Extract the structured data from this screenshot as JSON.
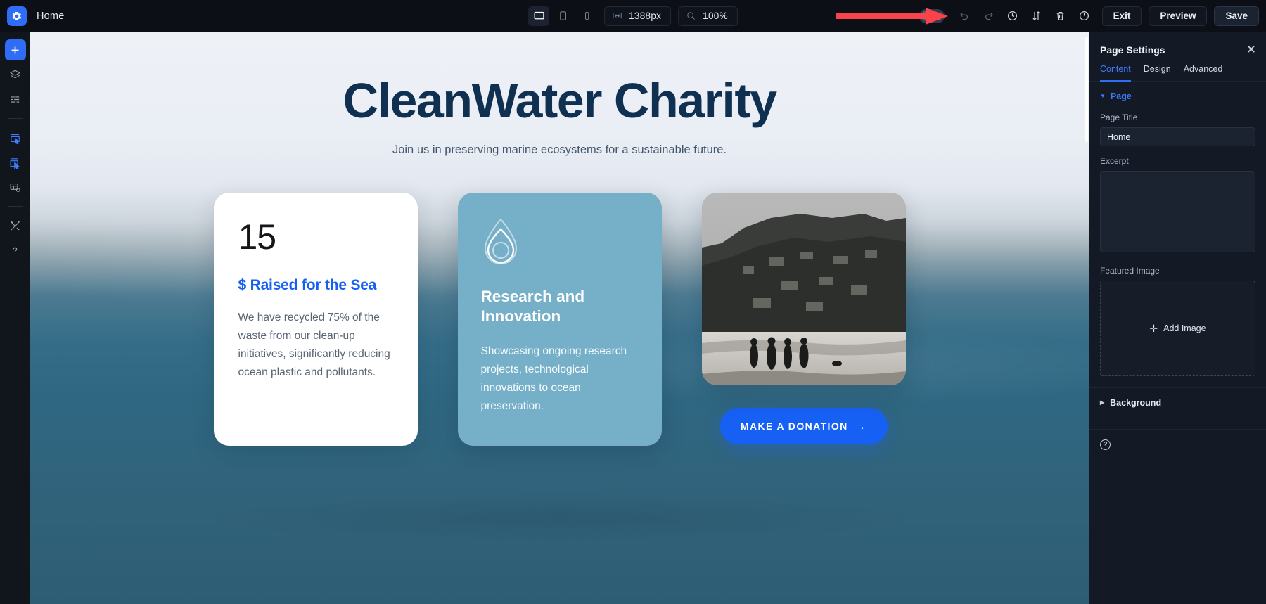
{
  "topbar": {
    "gear_icon": "gear-icon",
    "page_name": "Home",
    "devices": [
      {
        "name": "desktop",
        "icon": "desktop-icon",
        "active": true
      },
      {
        "name": "tablet",
        "icon": "tablet-icon",
        "active": false
      },
      {
        "name": "mobile",
        "icon": "mobile-icon",
        "active": false
      }
    ],
    "width_field": {
      "icon": "width-arrows-icon",
      "value": "1388px"
    },
    "zoom_field": {
      "icon": "magnifier-icon",
      "value": "100%"
    },
    "dark_mode_toggle": {
      "icon": "moon-icon",
      "state": "off"
    },
    "tools": [
      {
        "name": "undo",
        "icon": "undo-icon"
      },
      {
        "name": "redo",
        "icon": "redo-icon"
      },
      {
        "name": "history",
        "icon": "clock-icon"
      },
      {
        "name": "reorder",
        "icon": "sort-arrows-icon"
      },
      {
        "name": "delete",
        "icon": "trash-icon"
      },
      {
        "name": "power",
        "icon": "power-icon"
      }
    ],
    "exit_label": "Exit",
    "preview_label": "Preview",
    "save_label": "Save"
  },
  "rail": {
    "items": [
      {
        "name": "add",
        "icon": "plus-icon"
      },
      {
        "name": "layers",
        "icon": "layers-icon"
      },
      {
        "name": "list",
        "icon": "list-icon"
      },
      {
        "name": "select-element",
        "icon": "select-element-icon"
      },
      {
        "name": "duplicate-element",
        "icon": "duplicate-element-icon"
      },
      {
        "name": "data-source",
        "icon": "database-icon"
      },
      {
        "name": "tools",
        "icon": "tools-icon"
      },
      {
        "name": "help",
        "icon": "question-mark-icon"
      }
    ]
  },
  "canvas": {
    "hero": {
      "title": "CleanWater Charity",
      "subtitle": "Join us in preserving marine ecosystems for a sustainable future."
    },
    "cards": [
      {
        "type": "stat",
        "number": "15",
        "label": "$ Raised for the Sea",
        "text": "We have recycled 75% of the waste from our clean-up initiatives, significantly reducing ocean plastic and pollutants."
      },
      {
        "type": "feature",
        "icon": "water-drop-icon",
        "title": "Research and Innovation",
        "text": "Showcasing ongoing research projects, technological innovations to ocean preservation.",
        "bg_color": "#76afc8"
      },
      {
        "type": "media",
        "image_alt": "grayscale-beach-photo",
        "button_label": "MAKE A DONATION",
        "button_arrow": "→",
        "button_color": "#1660f3"
      }
    ]
  },
  "panel": {
    "title": "Page Settings",
    "close_icon": "close-icon",
    "tabs": [
      {
        "label": "Content",
        "active": true
      },
      {
        "label": "Design",
        "active": false
      },
      {
        "label": "Advanced",
        "active": false
      }
    ],
    "section_page_label": "Page",
    "page_title_label": "Page Title",
    "page_title_value": "Home",
    "excerpt_label": "Excerpt",
    "excerpt_value": "",
    "featured_image_label": "Featured Image",
    "add_image_label": "Add Image",
    "background_label": "Background",
    "help_icon": "question-mark-icon"
  }
}
